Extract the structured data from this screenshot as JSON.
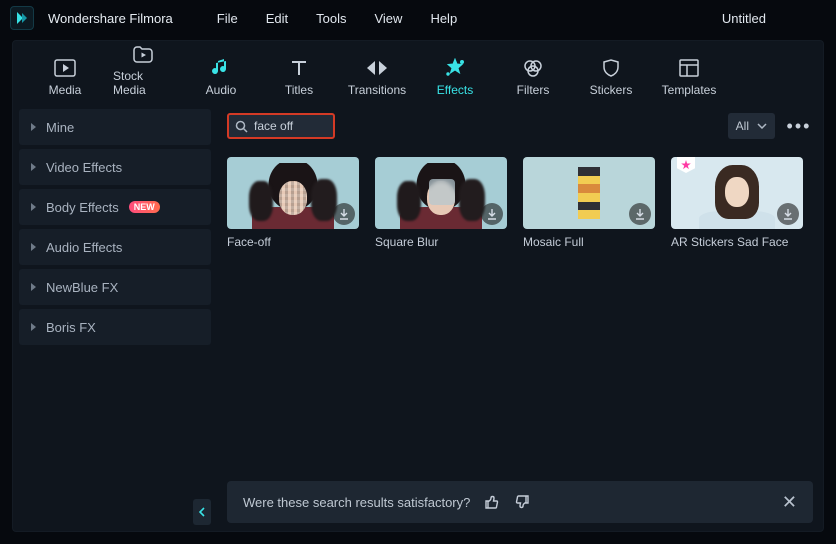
{
  "app": {
    "name": "Wondershare Filmora",
    "project": "Untitled"
  },
  "menu": {
    "items": [
      "File",
      "Edit",
      "Tools",
      "View",
      "Help"
    ]
  },
  "tabs": [
    {
      "id": "media",
      "label": "Media"
    },
    {
      "id": "stock-media",
      "label": "Stock Media"
    },
    {
      "id": "audio",
      "label": "Audio"
    },
    {
      "id": "titles",
      "label": "Titles"
    },
    {
      "id": "transitions",
      "label": "Transitions"
    },
    {
      "id": "effects",
      "label": "Effects",
      "active": true
    },
    {
      "id": "filters",
      "label": "Filters"
    },
    {
      "id": "stickers",
      "label": "Stickers"
    },
    {
      "id": "templates",
      "label": "Templates"
    }
  ],
  "sidebar": {
    "items": [
      {
        "label": "Mine"
      },
      {
        "label": "Video Effects"
      },
      {
        "label": "Body Effects",
        "badge": "NEW"
      },
      {
        "label": "Audio Effects"
      },
      {
        "label": "NewBlue FX"
      },
      {
        "label": "Boris FX"
      }
    ]
  },
  "search": {
    "value": "face off"
  },
  "filter": {
    "label": "All"
  },
  "results": [
    {
      "label": "Face-off",
      "selected": true
    },
    {
      "label": "Square Blur"
    },
    {
      "label": "Mosaic Full"
    },
    {
      "label": "AR Stickers Sad Face"
    }
  ],
  "feedback": {
    "prompt": "Were these search results satisfactory?"
  }
}
